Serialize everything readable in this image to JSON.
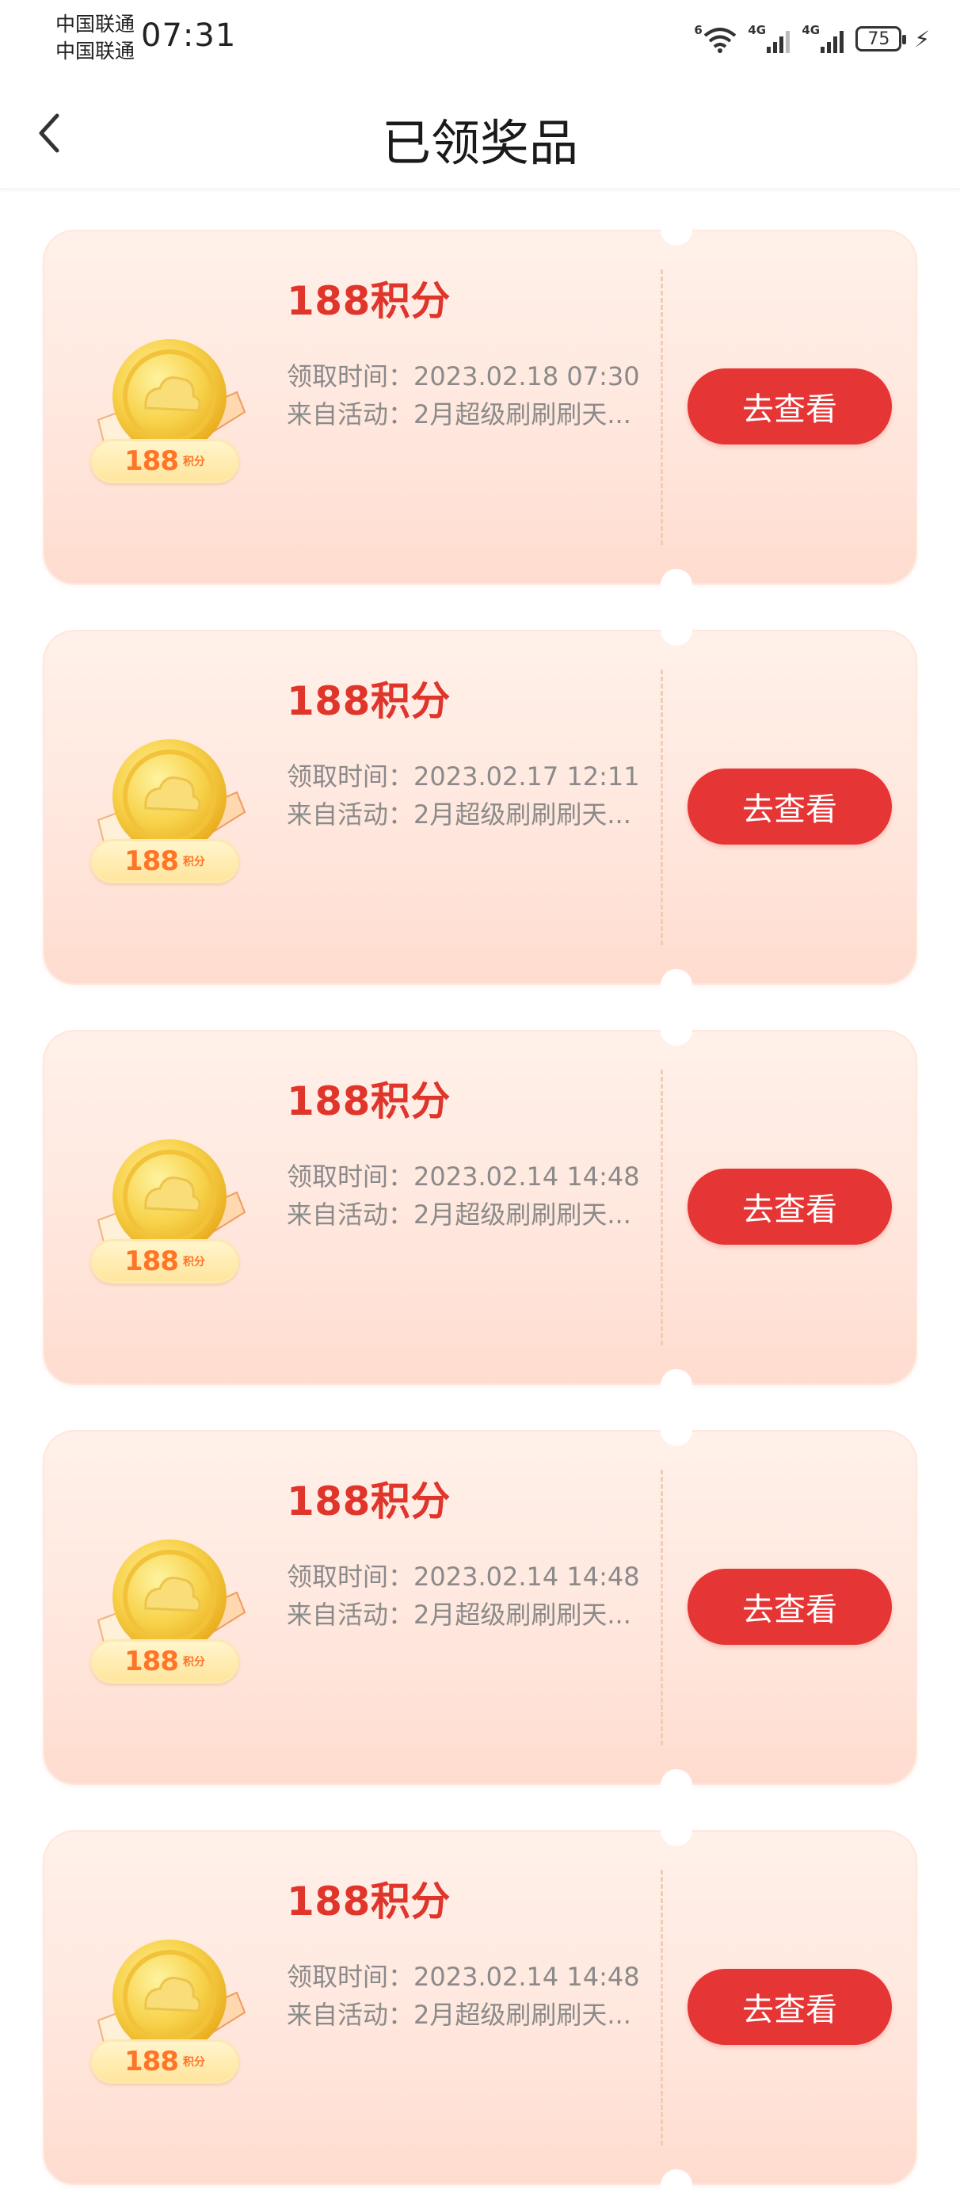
{
  "status_bar": {
    "carrier_1": "中国联通",
    "carrier_2": "中国联通",
    "time": "07:31",
    "wifi_tag": "6",
    "signal_1_tag": "4G",
    "signal_2_tag": "4G",
    "battery": "75"
  },
  "header": {
    "title": "已领奖品",
    "back_icon": "chevron-left-icon"
  },
  "colors": {
    "accent": "#e53535",
    "title_red": "#e0352b",
    "card_bg": "#ffe8de",
    "badge_orange": "#ff7426",
    "coin_gold": "#f7cf3a"
  },
  "prizes": [
    {
      "title": "188积分",
      "time_label": "领取时间：",
      "time": "2023.02.18 07:30",
      "source_label": "来自活动：",
      "source": "2月超级刷刷刷天...",
      "badge_value": "188",
      "badge_unit": "积分",
      "button": "去查看"
    },
    {
      "title": "188积分",
      "time_label": "领取时间：",
      "time": "2023.02.17 12:11",
      "source_label": "来自活动：",
      "source": "2月超级刷刷刷天...",
      "badge_value": "188",
      "badge_unit": "积分",
      "button": "去查看"
    },
    {
      "title": "188积分",
      "time_label": "领取时间：",
      "time": "2023.02.14 14:48",
      "source_label": "来自活动：",
      "source": "2月超级刷刷刷天...",
      "badge_value": "188",
      "badge_unit": "积分",
      "button": "去查看"
    },
    {
      "title": "188积分",
      "time_label": "领取时间：",
      "time": "2023.02.14 14:48",
      "source_label": "来自活动：",
      "source": "2月超级刷刷刷天...",
      "badge_value": "188",
      "badge_unit": "积分",
      "button": "去查看"
    },
    {
      "title": "188积分",
      "time_label": "领取时间：",
      "time": "2023.02.14 14:48",
      "source_label": "来自活动：",
      "source": "2月超级刷刷刷天...",
      "badge_value": "188",
      "badge_unit": "积分",
      "button": "去查看"
    }
  ]
}
